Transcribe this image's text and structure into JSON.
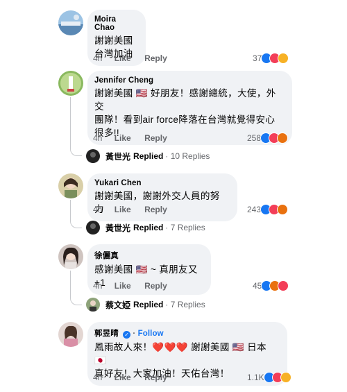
{
  "comments": [
    {
      "author": "Moira Chao",
      "lines": [
        "謝謝美國",
        "台灣加油"
      ],
      "time": "4h",
      "like_label": "Like",
      "reply_label": "Reply",
      "reaction_count": "37",
      "reactions": [
        "like",
        "love",
        "haha"
      ]
    },
    {
      "author": "Jennifer Cheng",
      "lines": [
        "謝謝美國 🇺🇸 好朋友！感謝總統，大使，外交",
        "團隊！看到air force降落在台灣就覺得安心",
        "很多!!"
      ],
      "time": "4h",
      "like_label": "Like",
      "reply_label": "Reply",
      "reaction_count": "258",
      "reactions": [
        "like",
        "love",
        "angry"
      ],
      "replied": {
        "name": "黃世光",
        "label": "Replied",
        "count": "· 10 Replies"
      }
    },
    {
      "author": "Yukari Chen",
      "lines": [
        "謝謝美國，謝謝外交人員的努力"
      ],
      "time": "4h",
      "like_label": "Like",
      "reply_label": "Reply",
      "reaction_count": "243",
      "reactions": [
        "like",
        "love",
        "angry"
      ],
      "replied": {
        "name": "黃世光",
        "label": "Replied",
        "count": "· 7 Replies"
      }
    },
    {
      "author": "徐儷真",
      "lines": [
        "感謝美國 🇺🇸 ~ 真朋友又 +1"
      ],
      "time": "4h",
      "like_label": "Like",
      "reply_label": "Reply",
      "reaction_count": "45",
      "reactions": [
        "like",
        "angry",
        "love"
      ],
      "replied": {
        "name": "蔡文婭",
        "label": "Replied",
        "count": "· 7 Replies"
      }
    },
    {
      "author": "郭昱晴",
      "follow": "Follow",
      "lines": [
        "風雨故人來！❤️❤️❤️ 謝謝美國 🇺🇸 日本 🇯🇵",
        "真好友！大家加油！天佑台灣！"
      ],
      "time": "4h",
      "like_label": "Like",
      "reply_label": "Reply",
      "reaction_count": "1.1K",
      "reactions": [
        "like",
        "love",
        "care"
      ]
    }
  ],
  "colors": {
    "like": "#1877f2",
    "love": "#f33e58",
    "haha": "#f7b125",
    "angry": "#e9710f",
    "bubble": "#f0f2f5"
  }
}
